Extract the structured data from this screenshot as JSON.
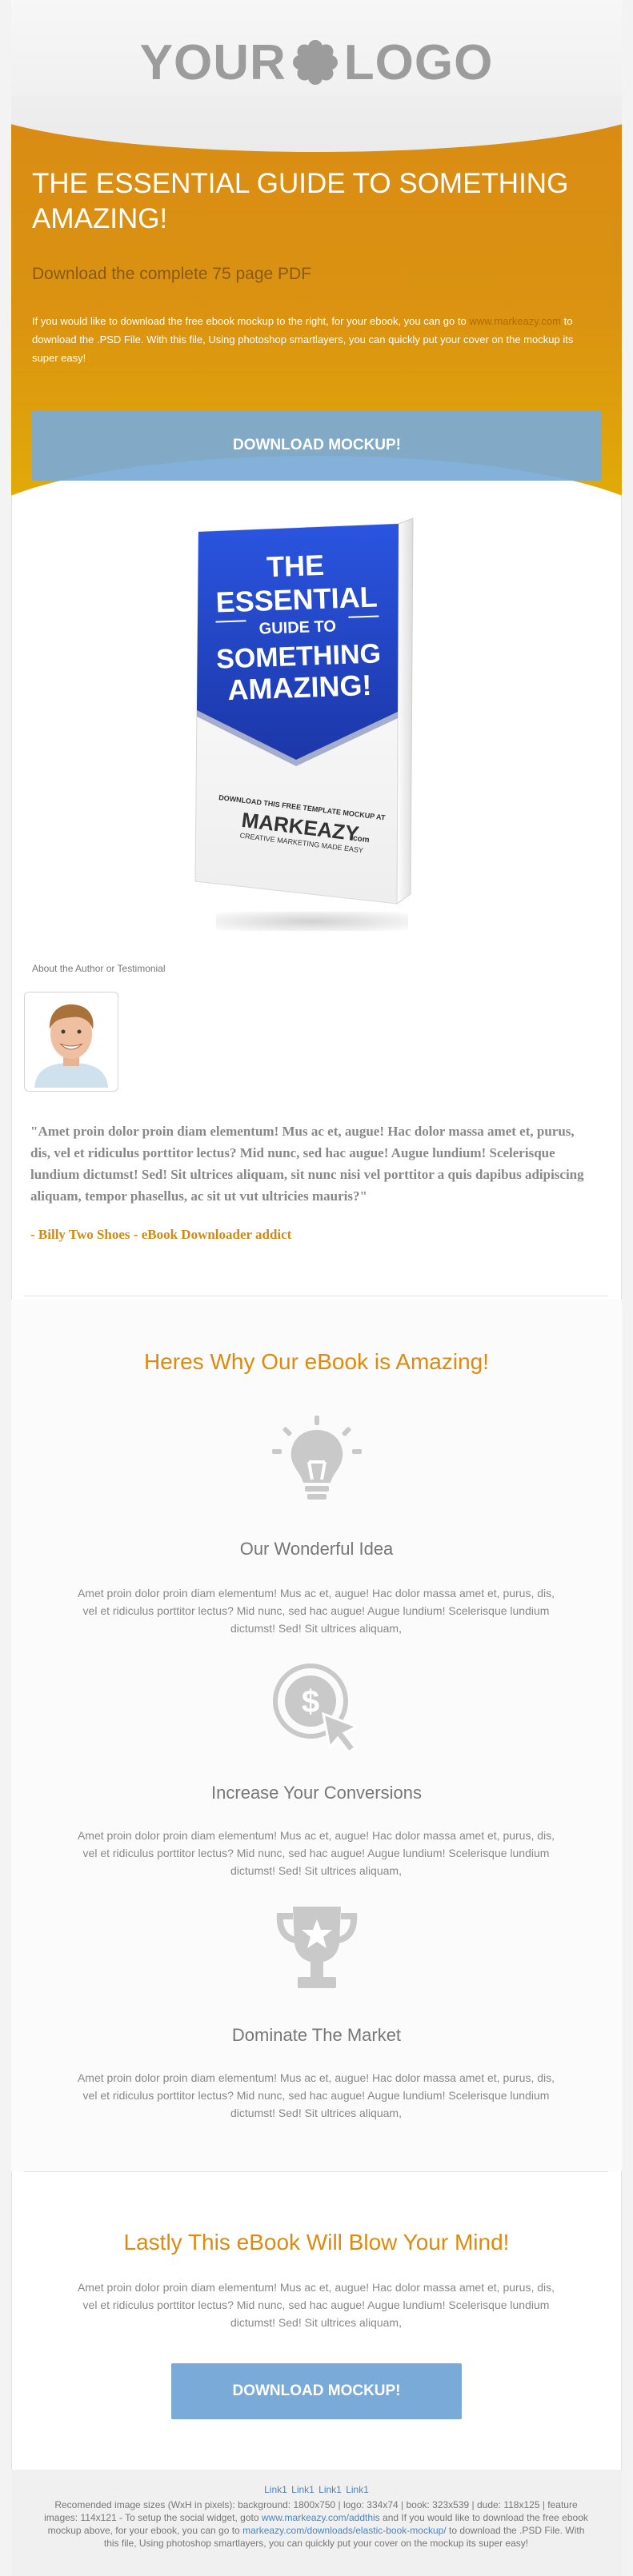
{
  "header": {
    "logo_left": "YOUR",
    "logo_right": "LOGO"
  },
  "hero": {
    "title": "THE ESSENTIAL GUIDE TO SOMETHING AMAZING!",
    "subtitle": "Download the complete 75 page PDF",
    "text_1": "If you would like to download the free ebook mockup to the right, for your ebook, you can go to",
    "link": "www.markeazy.com",
    "text_2": "to download the .PSD File. With this file, Using photoshop smartlayers, you can quickly put your cover on the mockup its super easy!",
    "button": "DOWNLOAD MOCKUP!"
  },
  "book": {
    "line1": "THE",
    "line2": "ESSENTIAL",
    "line3": "GUIDE TO",
    "line4": "SOMETHING",
    "line5": "AMAZING!",
    "small_text": "DOWNLOAD THIS FREE TEMPLATE MOCKUP AT",
    "brand": "MARKEAZY",
    "brand_suffix": ".com",
    "tagline": "CREATIVE MARKETING MADE EASY"
  },
  "testimonial": {
    "label": "About the Author or Testimonial",
    "quote": "\"Amet proin dolor proin diam elementum! Mus ac et, augue! Hac dolor massa amet et, purus, dis, vel et ridiculus porttitor lectus? Mid nunc, sed hac augue! Augue lundium! Scelerisque lundium dictumst! Sed! Sit ultrices aliquam, sit nunc nisi vel porttitor a quis dapibus adipiscing aliquam, tempor phasellus, ac sit ut vut ultricies mauris?\"",
    "author": "- Billy Two Shoes - eBook Downloader addict"
  },
  "features": {
    "title": "Heres Why Our eBook is Amazing!",
    "items": [
      {
        "title": "Our Wonderful Idea",
        "icon": "lightbulb-icon",
        "text": "Amet proin dolor proin diam elementum! Mus ac et, augue! Hac dolor massa amet et, purus, dis, vel et ridiculus porttitor lectus? Mid nunc, sed hac augue! Augue lundium! Scelerisque lundium dictumst! Sed! Sit ultrices aliquam,"
      },
      {
        "title": "Increase Your Conversions",
        "icon": "dollar-click-icon",
        "text": "Amet proin dolor proin diam elementum! Mus ac et, augue! Hac dolor massa amet et, purus, dis, vel et ridiculus porttitor lectus? Mid nunc, sed hac augue! Augue lundium! Scelerisque lundium dictumst! Sed! Sit ultrices aliquam,"
      },
      {
        "title": "Dominate The Market",
        "icon": "trophy-icon",
        "text": "Amet proin dolor proin diam elementum! Mus ac et, augue! Hac dolor massa amet et, purus, dis, vel et ridiculus porttitor lectus? Mid nunc, sed hac augue! Augue lundium! Scelerisque lundium dictumst! Sed! Sit ultrices aliquam,"
      }
    ]
  },
  "closing": {
    "title": "Lastly This eBook Will Blow Your Mind!",
    "text": "Amet proin dolor proin diam elementum! Mus ac et, augue! Hac dolor massa amet et, purus, dis, vel et ridiculus porttitor lectus? Mid nunc, sed hac augue! Augue lundium! Scelerisque lundium dictumst! Sed! Sit ultrices aliquam,",
    "button": "DOWNLOAD MOCKUP!"
  },
  "footer": {
    "links": [
      "Link1",
      "Link1",
      "Link1",
      "Link1"
    ],
    "text_1": "Recomended image sizes (WxH in pixels): background: 1800x750 | logo: 334x74 | book: 323x539 | dude: 118x125 | feature images: 114x121 - To setup the social widget, goto",
    "link_1": "www.markeazy.com/addthis",
    "text_2": "and If you would like to download the free ebook mockup above, for your ebook, you can go to",
    "link_2": "markeazy.com/downloads/elastic-book-mockup/",
    "text_3": "to download the .PSD File. With this file, Using photoshop smartlayers, you can quickly put your cover on the mockup its super easy!"
  },
  "colors": {
    "accent_orange": "#dd8a10",
    "button_blue": "#7aaad7",
    "book_blue": "#2447c8",
    "link_blue": "#4a86c5"
  }
}
